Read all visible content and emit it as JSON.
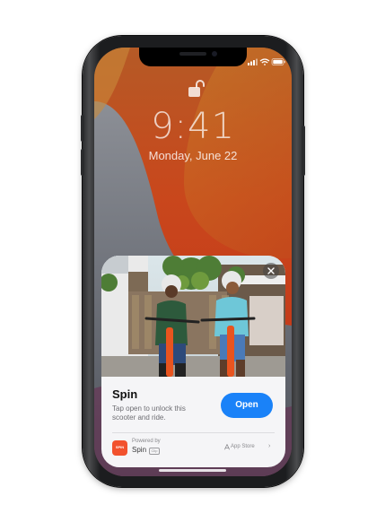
{
  "lock_screen": {
    "time": "9:41",
    "date": "Monday, June 22"
  },
  "app_clip_card": {
    "app_name": "Spin",
    "description": "Tap open to unlock this scooter and ride.",
    "open_button": "Open",
    "powered_by_label": "Powered by",
    "powered_by_name": "Spin",
    "clip_badge": "Clip",
    "app_store_link": "App Store",
    "logo_text": "SPIN",
    "chevron": "›"
  },
  "colors": {
    "accent": "#1a82f8",
    "brand": "#f2522e"
  },
  "icons": [
    "lock-open-icon",
    "cellular-icon",
    "wifi-icon",
    "battery-icon",
    "close-icon",
    "app-store-icon",
    "chevron-right-icon"
  ]
}
